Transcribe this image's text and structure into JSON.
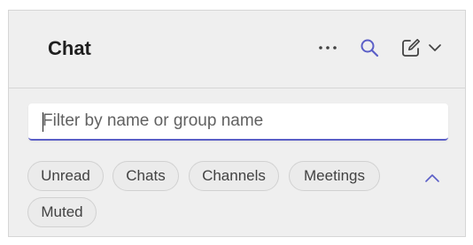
{
  "header": {
    "title": "Chat",
    "icons": {
      "more": "more-options-icon",
      "search": "search-icon",
      "compose": "new-chat-icon",
      "compose_menu": "chevron-down-icon"
    }
  },
  "filter": {
    "placeholder": "Filter by name or group name",
    "value": ""
  },
  "filters": {
    "pills": [
      "Unread",
      "Chats",
      "Channels",
      "Meetings",
      "Muted"
    ],
    "collapse_icon": "chevron-up-icon"
  },
  "colors": {
    "accent": "#5b5fc7",
    "panel_bg": "#efefef",
    "pill_bg": "#ebebeb",
    "text": "#1f1f1f"
  }
}
